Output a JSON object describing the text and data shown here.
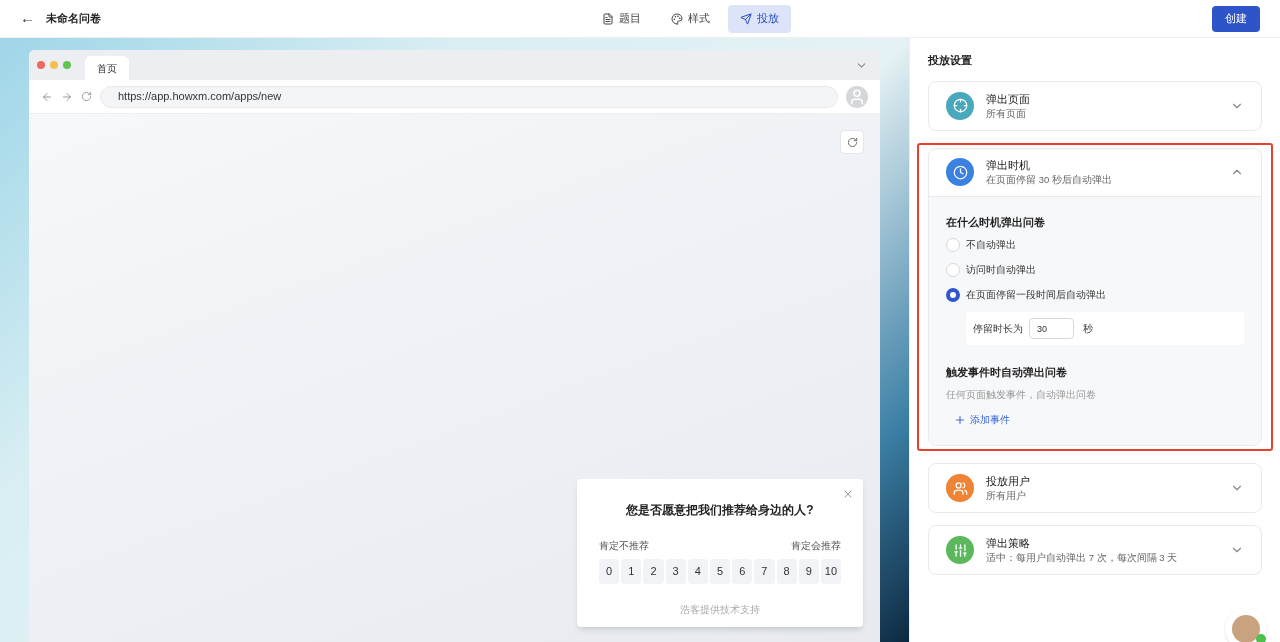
{
  "header": {
    "back": "←",
    "title": "未命名问卷",
    "tabs": [
      {
        "kind": "questions",
        "label": "题目",
        "selected": false
      },
      {
        "kind": "style",
        "label": "样式",
        "selected": false
      },
      {
        "kind": "publish",
        "label": "投放",
        "selected": true
      }
    ],
    "create_button": "创建"
  },
  "browser": {
    "tab": "首页",
    "url": "https://app.howxm.com/apps/new"
  },
  "survey": {
    "question": "您是否愿意把我们推荐给身边的人?",
    "low_label": "肯定不推荐",
    "high_label": "肯定会推荐",
    "scores": [
      "0",
      "1",
      "2",
      "3",
      "4",
      "5",
      "6",
      "7",
      "8",
      "9",
      "10"
    ],
    "footer": "浩客提供技术支持"
  },
  "settings": {
    "title": "投放设置",
    "sections": [
      {
        "kind": "page",
        "title": "弹出页面",
        "summary": "所有页面",
        "color": "#4aa8bd",
        "expanded": false,
        "highlighted": false
      },
      {
        "kind": "timing",
        "title": "弹出时机",
        "summary": "在页面停留 30 秒后自动弹出",
        "color": "#3b82e0",
        "expanded": true,
        "highlighted": true,
        "body": {
          "question": "在什么时机弹出问卷",
          "options": [
            {
              "label": "不自动弹出",
              "selected": false
            },
            {
              "label": "访问时自动弹出",
              "selected": false
            },
            {
              "label": "在页面停留一段时间后自动弹出",
              "selected": true
            }
          ],
          "duration_label": "停留时长为",
          "duration_value": "30",
          "duration_unit": "秒",
          "event_title": "触发事件时自动弹出问卷",
          "event_hint": "任何页面触发事件，自动弹出问卷",
          "add_event": "添加事件"
        }
      },
      {
        "kind": "users",
        "title": "投放用户",
        "summary": "所有用户",
        "color": "#ee8434",
        "expanded": false,
        "highlighted": false
      },
      {
        "kind": "strategy",
        "title": "弹出策略",
        "summary": "适中：每用户自动弹出 7 次，每次间隔 3 天",
        "color": "#5cb85c",
        "expanded": false,
        "highlighted": false
      }
    ]
  }
}
